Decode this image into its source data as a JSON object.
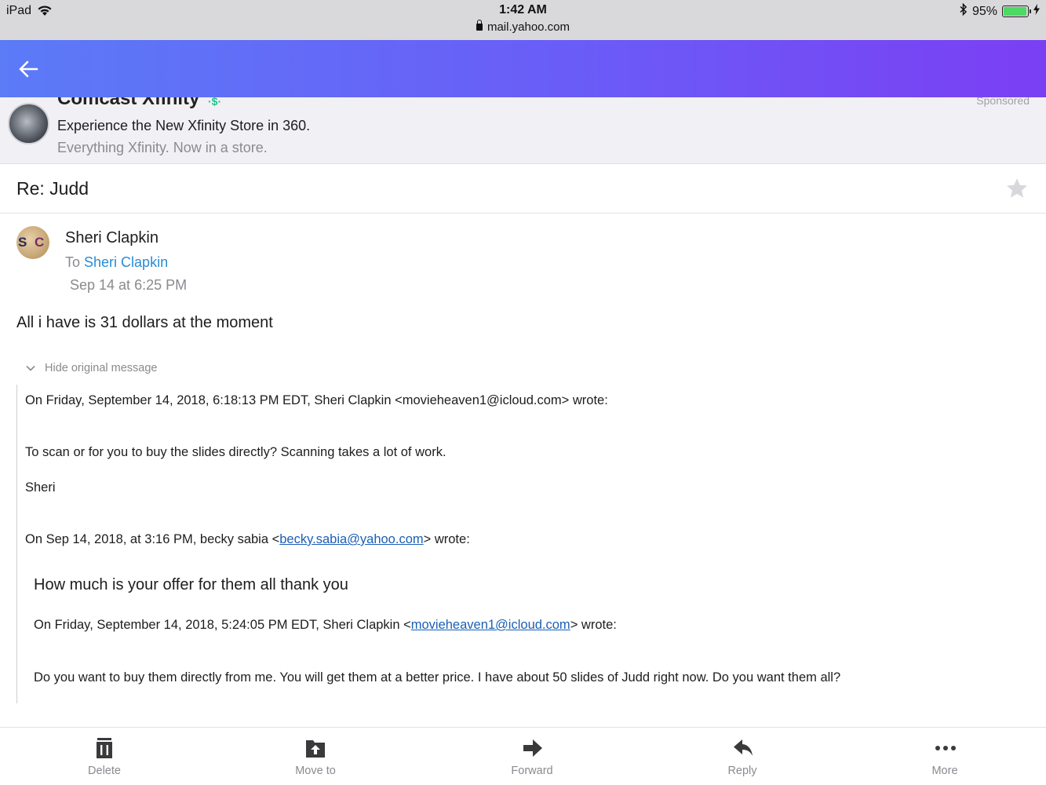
{
  "status_bar": {
    "device": "iPad",
    "time": "1:42 AM",
    "url": "mail.yahoo.com",
    "battery": "95%",
    "battery_level": 0.95
  },
  "ad": {
    "sponsor": "Comcast Xfinity",
    "headline": "Experience the New Xfinity Store in 360.",
    "subline": "Everything Xfinity. Now in a store.",
    "sponsored_label": "Sponsored"
  },
  "email": {
    "subject": "Re: Judd",
    "sender_name": "Sheri Clapkin",
    "to_label": "To",
    "to_name": "Sheri Clapkin",
    "date": "Sep 14 at 6:25 PM",
    "body": "All i have is 31 dollars at the moment",
    "hide_original": "Hide original message",
    "quoted": {
      "header1": "On Friday, September 14, 2018, 6:18:13 PM EDT, Sheri Clapkin <movieheaven1@icloud.com> wrote:",
      "line1": "To scan or for you to buy the slides directly? Scanning takes a lot of work.",
      "signature": "Sheri",
      "header2_prefix": "On Sep 14, 2018, at 3:16 PM, becky sabia <",
      "header2_email": "becky.sabia@yahoo.com",
      "header2_suffix": "> wrote:",
      "line2": "How much is your offer for them all thank you",
      "header3_prefix": "On Friday, September 14, 2018, 5:24:05 PM EDT, Sheri Clapkin <",
      "header3_email": "movieheaven1@icloud.com",
      "header3_suffix": "> wrote:",
      "line3": "Do you want to buy them directly from me. You will get them at a better price. I have about 50 slides of Judd right now. Do you want them all?"
    }
  },
  "toolbar": {
    "delete": "Delete",
    "move_to": "Move to",
    "forward": "Forward",
    "reply": "Reply",
    "more": "More"
  },
  "colors": {
    "header_gradient_start": "#5b7bf7",
    "header_gradient_end": "#7b3ff3",
    "link": "#2a8bd6",
    "battery": "#4cd964"
  }
}
